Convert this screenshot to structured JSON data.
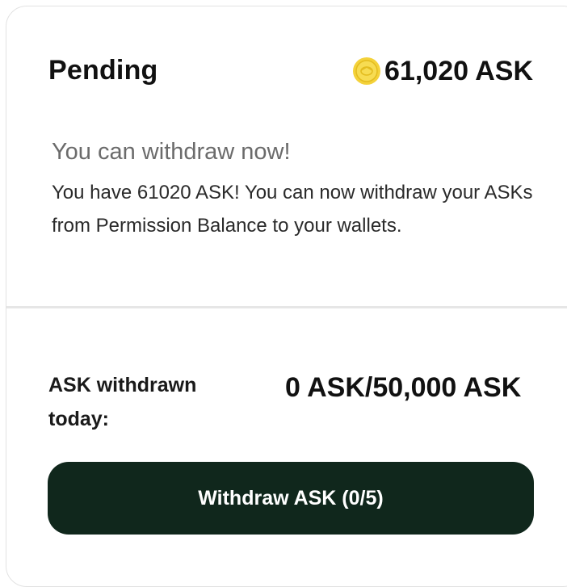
{
  "header": {
    "title": "Pending",
    "balance": "61,020 ASK",
    "coin_icon": "ask-coin-icon",
    "coin_color": "#f2d12b"
  },
  "notice": {
    "title": "You can withdraw now!",
    "body": "You have 61020 ASK! You can now withdraw your ASKs from Permission Balance to your wallets."
  },
  "stats": {
    "withdrawn_label": "ASK withdrawn today:",
    "withdrawn_value": "0 ASK/50,000 ASK"
  },
  "actions": {
    "withdraw_label": "Withdraw ASK (0/5)",
    "button_color": "#10271c"
  }
}
